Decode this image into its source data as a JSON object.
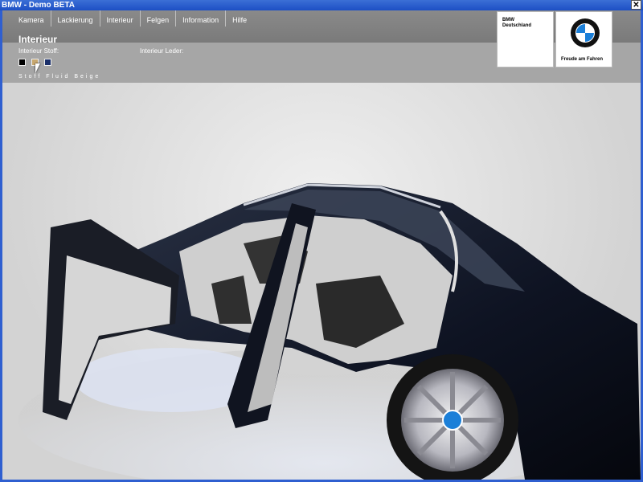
{
  "window": {
    "title": "BMW - Demo BETA",
    "close_label": "✕"
  },
  "menu": {
    "items": [
      {
        "label": "Kamera"
      },
      {
        "label": "Lackierung"
      },
      {
        "label": "Interieur"
      },
      {
        "label": "Felgen"
      },
      {
        "label": "Information"
      },
      {
        "label": "Hilfe"
      }
    ]
  },
  "panel": {
    "title": "Interieur",
    "stoff_label": "Interieur Stoff:",
    "leder_label": "Interieur Leder:",
    "swatches": [
      {
        "name": "black-swatch",
        "color": "#000000"
      },
      {
        "name": "beige-swatch",
        "color": "#c8a870"
      },
      {
        "name": "blue-swatch",
        "color": "#1a2f6a"
      }
    ],
    "selected_name": "Stoff Fluid Beige"
  },
  "logos": {
    "brand_text_line1": "BMW",
    "brand_text_line2": "Deutschland",
    "slogan": "Freude am Fahren"
  },
  "colors": {
    "car_paint": "#141a2a",
    "interior": "#d8d8d8",
    "accent": "#2f5fd0"
  }
}
